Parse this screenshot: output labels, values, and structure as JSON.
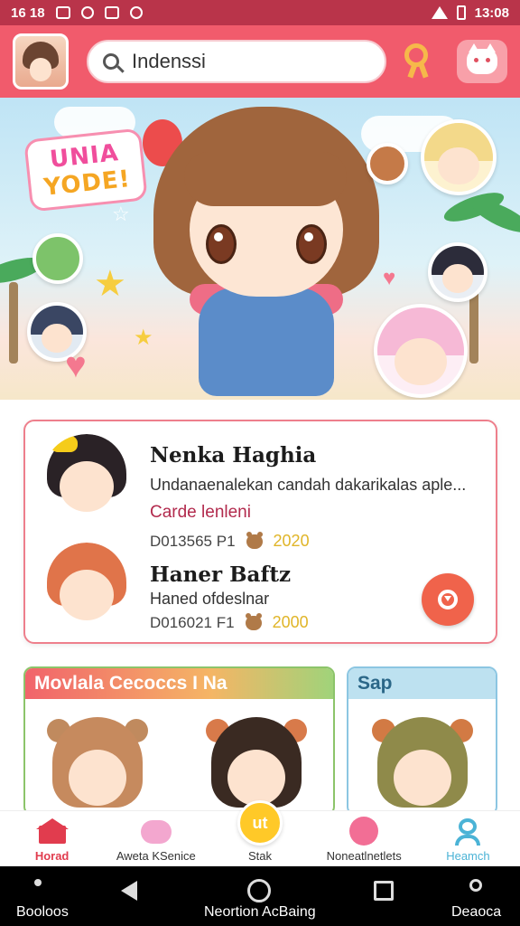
{
  "status_bar": {
    "time_left": "16 18",
    "time_right": "13:08"
  },
  "search": {
    "value": "Indenssi"
  },
  "banner": {
    "logo_line1": "UNIA",
    "logo_line2": "YODE!"
  },
  "featured": {
    "items": [
      {
        "title": "Nenka Haghia",
        "desc": "Undanaenalekan candah dakarikalas aple...",
        "sub": "Carde lenleni",
        "code": "D013565 P1",
        "year": "2020"
      },
      {
        "title": "Haner Baftz",
        "desc": "Haned ofdeslnar",
        "sub": "",
        "code": "D016021 F1",
        "year": "2000"
      }
    ]
  },
  "cards": [
    {
      "title": "Movlala Cecoccs I Na"
    },
    {
      "title": "Sap"
    }
  ],
  "tabs": [
    {
      "label": "Horad"
    },
    {
      "label": "Aweta KSenice"
    },
    {
      "label": "Stak",
      "center_text": "ut"
    },
    {
      "label": "Noneatlnetlets"
    },
    {
      "label": "Heamch"
    }
  ],
  "nav_labels": {
    "left": "Booloos",
    "center": "Neortion AcBaing",
    "right": "Deaoca"
  },
  "colors": {
    "brand_red": "#f15b6c",
    "statusbar": "#b9344a",
    "accent_orange": "#f0634b",
    "accent_yellow": "#ffc928"
  }
}
